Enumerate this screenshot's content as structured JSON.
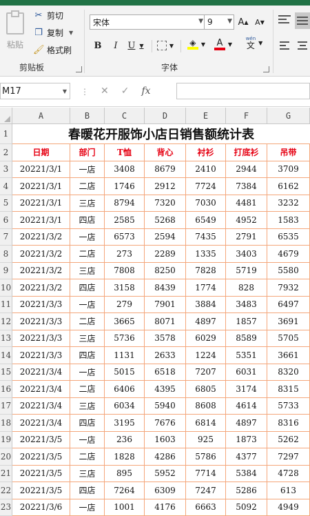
{
  "ribbon": {
    "clipboard": {
      "paste_label": "粘贴",
      "cut_label": "剪切",
      "copy_label": "复制",
      "format_painter_label": "格式刷",
      "group_label": "剪贴板"
    },
    "font": {
      "font_name": "宋体",
      "font_size": "9",
      "grow_label": "A",
      "shrink_label": "A",
      "bold_label": "B",
      "italic_label": "I",
      "underline_label": "U",
      "font_color_label": "A",
      "phonetic_label": "文",
      "phonetic_top": "wén",
      "group_label": "字体"
    },
    "colors": {
      "fill": "#ffff00",
      "font_color": "#e60012",
      "accent": "#217346"
    }
  },
  "formula_bar": {
    "name_box": "M17",
    "cancel_icon": "✕",
    "enter_icon": "✓",
    "fx_label": "fx",
    "formula": ""
  },
  "sheet": {
    "columns": [
      "A",
      "B",
      "C",
      "D",
      "E",
      "F",
      "G"
    ],
    "title": "春暖花开服饰小店日销售额统计表",
    "headers": [
      "日期",
      "部门",
      "T恤",
      "背心",
      "衬衫",
      "打底衫",
      "吊带"
    ],
    "row_numbers": [
      "1",
      "2",
      "3",
      "4",
      "5",
      "6",
      "7",
      "8",
      "9",
      "10",
      "11",
      "12",
      "13",
      "14",
      "15",
      "16",
      "17",
      "18",
      "19",
      "20",
      "21",
      "22",
      "23"
    ],
    "rows": [
      [
        "20221/3/1",
        "一店",
        "3408",
        "8679",
        "2410",
        "2944",
        "3709"
      ],
      [
        "20221/3/1",
        "二店",
        "1746",
        "2912",
        "7724",
        "7384",
        "6162"
      ],
      [
        "20221/3/1",
        "三店",
        "8794",
        "7320",
        "7030",
        "4481",
        "3232"
      ],
      [
        "20221/3/1",
        "四店",
        "2585",
        "5268",
        "6549",
        "4952",
        "1583"
      ],
      [
        "20221/3/2",
        "一店",
        "6573",
        "2594",
        "7435",
        "2791",
        "6535"
      ],
      [
        "20221/3/2",
        "二店",
        "273",
        "2289",
        "1335",
        "3403",
        "4679"
      ],
      [
        "20221/3/2",
        "三店",
        "7808",
        "8250",
        "7828",
        "5719",
        "5580"
      ],
      [
        "20221/3/2",
        "四店",
        "3158",
        "8439",
        "1774",
        "828",
        "7932"
      ],
      [
        "20221/3/3",
        "一店",
        "279",
        "7901",
        "3884",
        "3483",
        "6497"
      ],
      [
        "20221/3/3",
        "二店",
        "3665",
        "8071",
        "4897",
        "1857",
        "3691"
      ],
      [
        "20221/3/3",
        "三店",
        "5736",
        "3578",
        "6029",
        "8589",
        "5705"
      ],
      [
        "20221/3/3",
        "四店",
        "1131",
        "2633",
        "1224",
        "5351",
        "3661"
      ],
      [
        "20221/3/4",
        "一店",
        "5015",
        "6518",
        "7207",
        "6031",
        "8320"
      ],
      [
        "20221/3/4",
        "二店",
        "6406",
        "4395",
        "6805",
        "3174",
        "8315"
      ],
      [
        "20221/3/4",
        "三店",
        "6034",
        "5940",
        "8608",
        "4614",
        "5733"
      ],
      [
        "20221/3/4",
        "四店",
        "3195",
        "7676",
        "6814",
        "4897",
        "8316"
      ],
      [
        "20221/3/5",
        "一店",
        "236",
        "1603",
        "925",
        "1873",
        "5262"
      ],
      [
        "20221/3/5",
        "二店",
        "1828",
        "4286",
        "5786",
        "4377",
        "7297"
      ],
      [
        "20221/3/5",
        "三店",
        "895",
        "5952",
        "7714",
        "5384",
        "4728"
      ],
      [
        "20221/3/5",
        "四店",
        "7264",
        "6309",
        "7247",
        "5286",
        "613"
      ],
      [
        "20221/3/6",
        "一店",
        "1001",
        "4176",
        "6663",
        "5092",
        "4949"
      ]
    ]
  }
}
